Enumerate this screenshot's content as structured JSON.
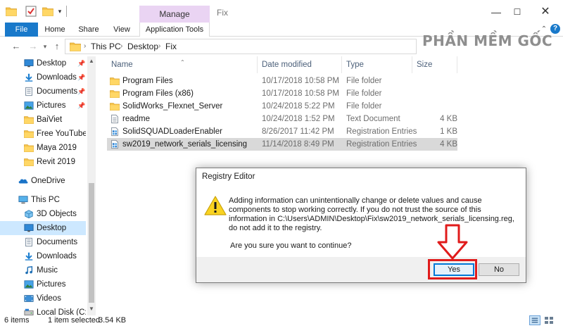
{
  "window": {
    "title": "Fix",
    "manage_tab": "Manage"
  },
  "ribbon": {
    "tabs": [
      "File",
      "Home",
      "Share",
      "View",
      "Application Tools"
    ]
  },
  "address": {
    "path": [
      "This PC",
      "Desktop",
      "Fix"
    ]
  },
  "watermark": "PHẦN MỀM GỐC",
  "nav": {
    "items": [
      {
        "label": "Desktop",
        "icon": "desktop-icon",
        "pinned": true
      },
      {
        "label": "Downloads",
        "icon": "download-icon",
        "pinned": true
      },
      {
        "label": "Documents",
        "icon": "documents-icon",
        "pinned": true
      },
      {
        "label": "Pictures",
        "icon": "pictures-icon",
        "pinned": true
      },
      {
        "label": "BaiViet",
        "icon": "folder-icon",
        "pinned": false
      },
      {
        "label": "Free YouTube Do",
        "icon": "folder-icon",
        "pinned": false
      },
      {
        "label": "Maya 2019",
        "icon": "folder-icon",
        "pinned": false
      },
      {
        "label": "Revit 2019",
        "icon": "folder-icon",
        "pinned": false
      },
      {
        "label": "OneDrive",
        "icon": "onedrive-icon",
        "pinned": false
      },
      {
        "label": "This PC",
        "icon": "this-pc-icon",
        "pinned": false
      },
      {
        "label": "3D Objects",
        "icon": "3d-objects-icon",
        "pinned": false
      },
      {
        "label": "Desktop",
        "icon": "desktop-icon",
        "pinned": false
      },
      {
        "label": "Documents",
        "icon": "documents-icon",
        "pinned": false
      },
      {
        "label": "Downloads",
        "icon": "download-icon",
        "pinned": false
      },
      {
        "label": "Music",
        "icon": "music-icon",
        "pinned": false
      },
      {
        "label": "Pictures",
        "icon": "pictures-icon",
        "pinned": false
      },
      {
        "label": "Videos",
        "icon": "videos-icon",
        "pinned": false
      },
      {
        "label": "Local Disk (C:)",
        "icon": "drive-icon",
        "pinned": false
      }
    ]
  },
  "columns": {
    "name": "Name",
    "date": "Date modified",
    "type": "Type",
    "size": "Size"
  },
  "files": [
    {
      "name": "Program Files",
      "date": "10/17/2018 10:58 PM",
      "type": "File folder",
      "size": "",
      "icon": "folder-icon"
    },
    {
      "name": "Program Files (x86)",
      "date": "10/17/2018 10:58 PM",
      "type": "File folder",
      "size": "",
      "icon": "folder-icon"
    },
    {
      "name": "SolidWorks_Flexnet_Server",
      "date": "10/24/2018 5:22 PM",
      "type": "File folder",
      "size": "",
      "icon": "folder-icon"
    },
    {
      "name": "readme",
      "date": "10/24/2018 1:52 PM",
      "type": "Text Document",
      "size": "4 KB",
      "icon": "text-document-icon"
    },
    {
      "name": "SolidSQUADLoaderEnabler",
      "date": "8/26/2017 11:42 PM",
      "type": "Registration Entries",
      "size": "1 KB",
      "icon": "registry-file-icon"
    },
    {
      "name": "sw2019_network_serials_licensing",
      "date": "11/14/2018 8:49 PM",
      "type": "Registration Entries",
      "size": "4 KB",
      "icon": "registry-file-icon",
      "selected": true
    }
  ],
  "status": {
    "count": "6 items",
    "selected": "1 item selected",
    "size": "3.54 KB"
  },
  "dialog": {
    "title": "Registry Editor",
    "message": "Adding information can unintentionally change or delete values and cause components to stop working correctly. If you do not trust the source of this information in C:\\Users\\ADMIN\\Desktop\\Fix\\sw2019_network_serials_licensing.reg, do not add it to the registry.",
    "question": "Are you sure you want to continue?",
    "yes": "Yes",
    "no": "No"
  },
  "colors": {
    "accent": "#1979ca",
    "manage": "#ead4f3",
    "selection": "#cde8ff",
    "highlight": "#e01b1b",
    "folder": "#f6c34a"
  }
}
